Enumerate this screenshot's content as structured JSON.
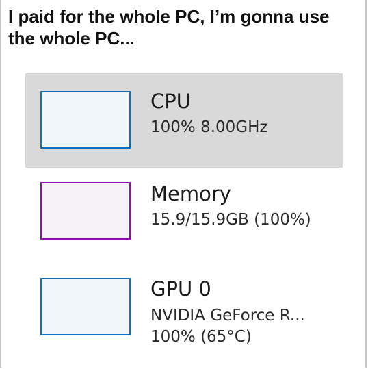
{
  "caption": {
    "line1": "I paid for the whole PC, I’m gonna use",
    "line2": "the whole PC..."
  },
  "performance_items": [
    {
      "title": "CPU",
      "detail": "100% 8.00GHz",
      "selected": true,
      "graph_color": "#1171c0"
    },
    {
      "title": "Memory",
      "detail": "15.9/15.9GB (100%)",
      "selected": false,
      "graph_color": "#8b12ae"
    },
    {
      "title": "GPU 0",
      "detail": "NVIDIA GeForce R...",
      "detail2": "100% (65°C)",
      "selected": false,
      "graph_color": "#1171c0"
    }
  ]
}
